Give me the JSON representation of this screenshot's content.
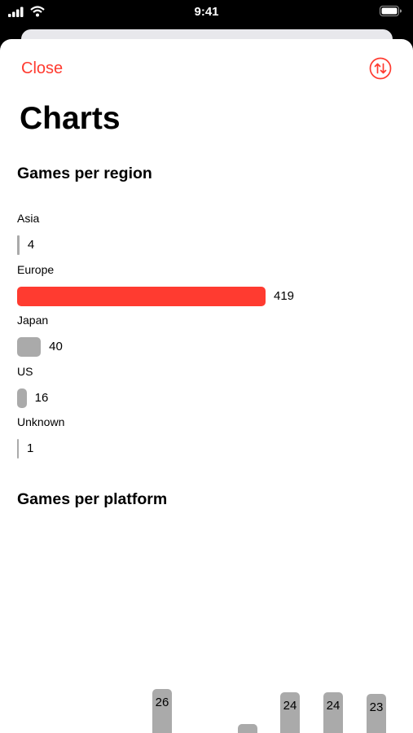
{
  "status_bar": {
    "time": "9:41"
  },
  "nav": {
    "close_label": "Close",
    "sort_icon": "arrow-up-arrow-down-circle-icon"
  },
  "page": {
    "title": "Charts"
  },
  "colors": {
    "accent": "#ff3b30",
    "bar_default": "#aaaaaa"
  },
  "chart_data": [
    {
      "type": "bar",
      "orientation": "horizontal",
      "title": "Games per region",
      "categories": [
        "Asia",
        "Europe",
        "Japan",
        "US",
        "Unknown"
      ],
      "values": [
        4,
        419,
        40,
        16,
        1
      ],
      "highlight": "Europe",
      "xlim": [
        0,
        419
      ]
    },
    {
      "type": "bar",
      "orientation": "vertical",
      "title": "Games per platform",
      "values": [
        26,
        24,
        24,
        23
      ]
    }
  ]
}
